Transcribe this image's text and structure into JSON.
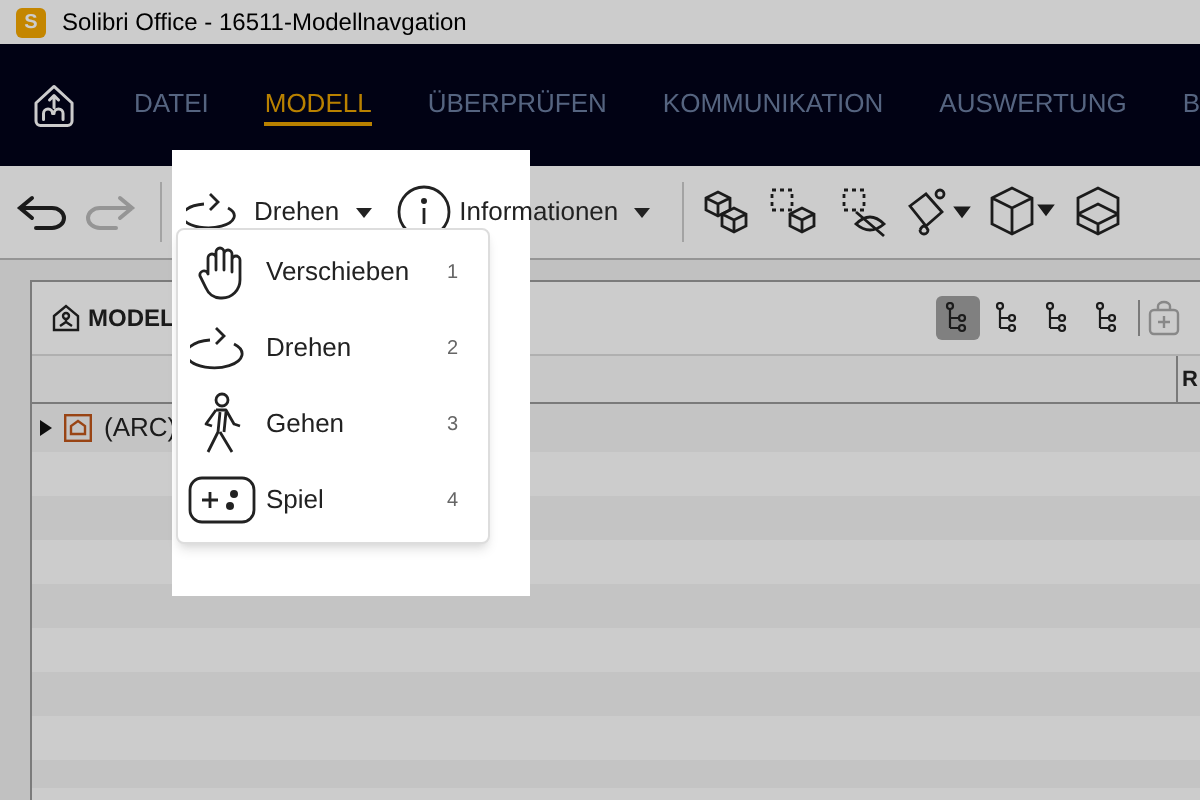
{
  "window": {
    "app_badge": "S",
    "title": "Solibri Office - 16511-Modellnavgation"
  },
  "nav": {
    "tabs": [
      {
        "label": "DATEI",
        "selected": false
      },
      {
        "label": "MODELL",
        "selected": true
      },
      {
        "label": "ÜBERPRÜFEN",
        "selected": false
      },
      {
        "label": "KOMMUNIKATION",
        "selected": false
      },
      {
        "label": "AUSWERTUNG",
        "selected": false
      },
      {
        "label": "B",
        "selected": false
      }
    ]
  },
  "toolbar": {
    "undo": {
      "disabled": false
    },
    "redo": {
      "disabled": true
    },
    "navigation_mode": {
      "label": "Drehen"
    },
    "info": {
      "label": "Informationen"
    }
  },
  "menu": {
    "items": [
      {
        "kind": "hand",
        "label": "Verschieben",
        "shortcut": "1"
      },
      {
        "kind": "orbit",
        "label": "Drehen",
        "shortcut": "2"
      },
      {
        "kind": "walk",
        "label": "Gehen",
        "shortcut": "3"
      },
      {
        "kind": "game",
        "label": "Spiel",
        "shortcut": "4"
      }
    ]
  },
  "panel": {
    "title": "MODEL",
    "view_buttons": [
      {
        "selected": true
      },
      {
        "selected": false
      },
      {
        "selected": false
      },
      {
        "selected": false
      }
    ],
    "column_1": "R",
    "tree": [
      {
        "label": "(ARC)",
        "expanded": false
      }
    ]
  }
}
